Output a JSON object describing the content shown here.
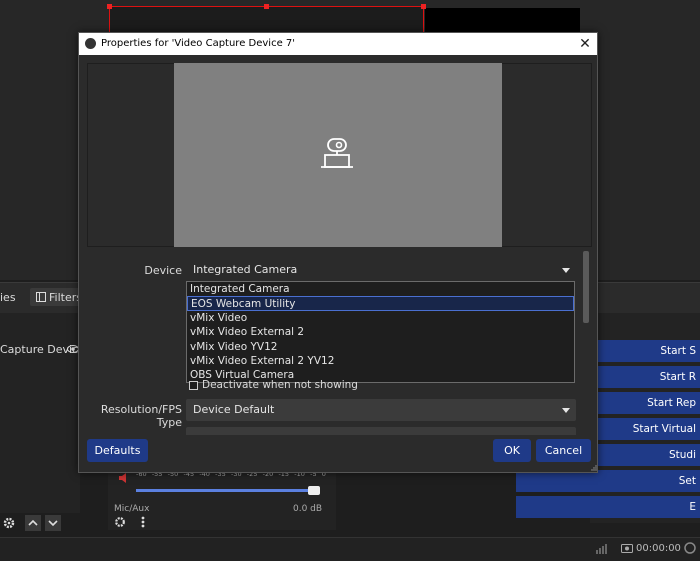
{
  "background": {
    "sources_tab_fragment": "ies",
    "filters_button": "Filters",
    "source_item": "Capture Device",
    "controls": [
      "Start S",
      "Start R",
      "Start Rep",
      "Start Virtual",
      "Studi",
      "Set",
      "E"
    ],
    "mixer": {
      "scale": [
        "-60",
        "-55",
        "-50",
        "-45",
        "-40",
        "-35",
        "-30",
        "-25",
        "-20",
        "-15",
        "-10",
        "-5",
        "0"
      ],
      "track_name": "Mic/Aux",
      "track_db": "0.0 dB"
    },
    "status_time": "00:00:00"
  },
  "dialog": {
    "title": "Properties for 'Video Capture Device 7'",
    "device_label": "Device",
    "device_value": "Integrated Camera",
    "device_options": [
      "Integrated Camera",
      "EOS Webcam Utility",
      "vMix Video",
      "vMix Video External 2",
      "vMix Video YV12",
      "vMix Video External 2 YV12",
      "OBS Virtual Camera"
    ],
    "selected_option_index": 1,
    "checkbox_label": "Deactivate when not showing",
    "resolution_label": "Resolution/FPS Type",
    "resolution_value": "Device Default",
    "defaults_button": "Defaults",
    "ok_button": "OK",
    "cancel_button": "Cancel"
  },
  "colors": {
    "accent_blue": "#1f3a88",
    "selection_border": "#4a6fd0",
    "selection_edge_red": "#dd1111"
  }
}
